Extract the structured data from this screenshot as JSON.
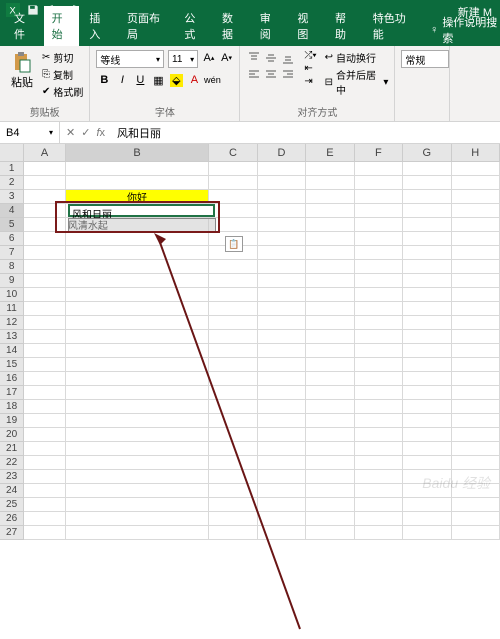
{
  "title": "新建 M",
  "tabs": {
    "file": "文件",
    "home": "开始",
    "insert": "插入",
    "layout": "页面布局",
    "formulas": "公式",
    "data": "数据",
    "review": "审阅",
    "view": "视图",
    "help": "帮助",
    "special": "特色功能"
  },
  "tellme": "操作说明搜索",
  "clipboard": {
    "paste": "粘贴",
    "cut": "剪切",
    "copy": "复制",
    "format_painter": "格式刷",
    "group": "剪贴板"
  },
  "font": {
    "name": "等线",
    "size": "11",
    "group": "字体"
  },
  "align": {
    "wrap": "自动换行",
    "merge": "合并后居中",
    "group": "对齐方式"
  },
  "num": {
    "format": "常规"
  },
  "namebox": "B4",
  "formula": "风和日丽",
  "cells": {
    "b3": "你好",
    "b4": "风和日丽",
    "b5": "风清水起"
  },
  "columns": [
    "A",
    "B",
    "C",
    "D",
    "E",
    "F",
    "G",
    "H"
  ],
  "chart_data": null,
  "watermark": "Baidu 经验"
}
